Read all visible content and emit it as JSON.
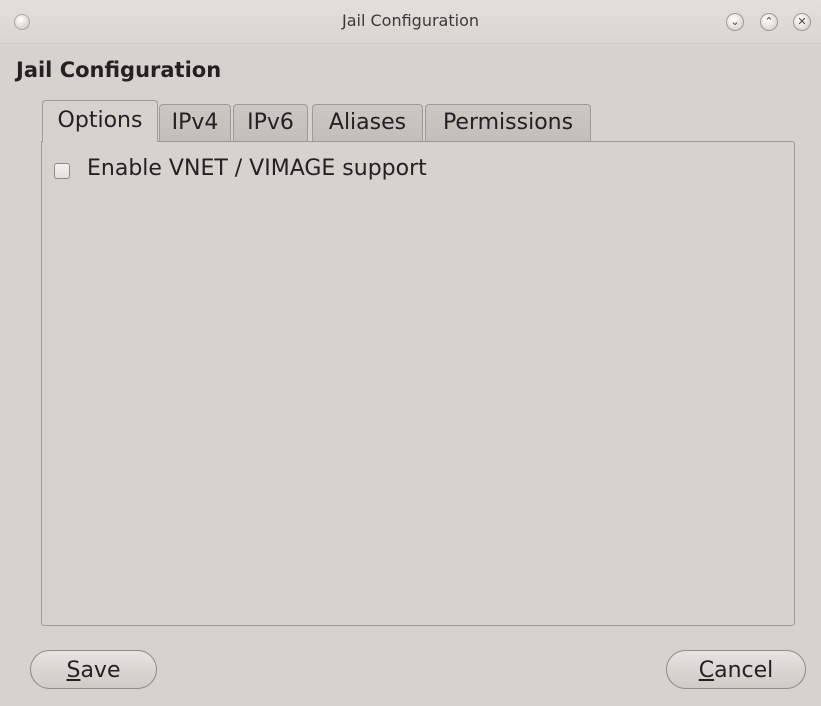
{
  "window": {
    "title": "Jail Configuration",
    "icons": [
      "window-menu-icon",
      "minimize-icon",
      "maximize-icon",
      "close-icon"
    ]
  },
  "heading": "Jail Configuration",
  "tabs": [
    {
      "label": "Options",
      "active": true
    },
    {
      "label": "IPv4",
      "active": false
    },
    {
      "label": "IPv6",
      "active": false
    },
    {
      "label": "Aliases",
      "active": false
    },
    {
      "label": "Permissions",
      "active": false
    }
  ],
  "options": {
    "vnet_checkbox": {
      "label": "Enable VNET / VIMAGE support",
      "checked": false
    }
  },
  "buttons": {
    "save": {
      "mnemonic": "S",
      "rest": "ave"
    },
    "cancel": {
      "mnemonic": "C",
      "rest": "ancel"
    }
  },
  "colors": {
    "background": "#d6d2ce",
    "border": "#9e9a96"
  }
}
